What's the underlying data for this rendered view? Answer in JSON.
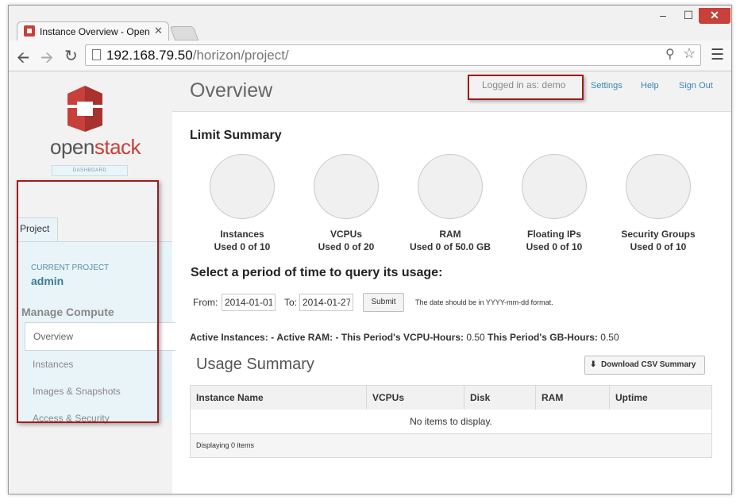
{
  "browser": {
    "tab_title": "Instance Overview - Open",
    "tab_close": "✕",
    "url_host": "192.168.79.50",
    "url_path": "/horizon/project/",
    "win_minimize": "–",
    "win_maximize": "☐",
    "win_close": "✕",
    "icons": [
      "back-arrow-icon",
      "forward-arrow-icon",
      "reload-icon",
      "page-icon",
      "zoom-icon",
      "star-icon",
      "menu-icon"
    ]
  },
  "brand": {
    "open": "open",
    "stack": "stack",
    "sub": "DASHBOARD",
    "color": "#c7403a"
  },
  "sidebar": {
    "tab_label": "Project",
    "current_project_label": "CURRENT PROJECT",
    "current_project": "admin",
    "section": "Manage Compute",
    "items": [
      {
        "label": "Overview",
        "active": true
      },
      {
        "label": "Instances",
        "active": false
      },
      {
        "label": "Images & Snapshots",
        "active": false
      },
      {
        "label": "Access & Security",
        "active": false
      }
    ]
  },
  "header": {
    "title": "Overview",
    "logged_in": "Logged in as: demo",
    "links": [
      "Settings",
      "Help",
      "Sign Out"
    ],
    "link_color": "#3a86b0"
  },
  "limits": {
    "title": "Limit Summary",
    "items": [
      {
        "name": "Instances",
        "used": "Used 0 of 10",
        "fraction": 0
      },
      {
        "name": "VCPUs",
        "used": "Used 0 of 20",
        "fraction": 0
      },
      {
        "name": "RAM",
        "used": "Used 0 of 50.0 GB",
        "fraction": 0
      },
      {
        "name": "Floating IPs",
        "used": "Used 0 of 10",
        "fraction": 0
      },
      {
        "name": "Security Groups",
        "used": "Used 0 of 10",
        "fraction": 0
      }
    ]
  },
  "period": {
    "title": "Select a period of time to query its usage:",
    "from_label": "From:",
    "from_value": "2014-01-01",
    "to_label": "To:",
    "to_value": "2014-01-27",
    "submit": "Submit",
    "hint": "The date should be in YYYY-mm-dd format."
  },
  "stats": {
    "active_instances_label": "Active Instances:",
    "active_instances_value": "-",
    "active_ram_label": "Active RAM:",
    "active_ram_value": "-",
    "vcpu_hours_label": "This Period's VCPU-Hours:",
    "vcpu_hours_value": "0.50",
    "gb_hours_label": "This Period's GB-Hours:",
    "gb_hours_value": "0.50"
  },
  "usage": {
    "title": "Usage Summary",
    "download": "Download CSV Summary",
    "columns": [
      "Instance Name",
      "VCPUs",
      "Disk",
      "RAM",
      "Uptime"
    ],
    "empty": "No items to display.",
    "footer": "Displaying 0 items"
  },
  "highlight_color": "#a11b1b"
}
